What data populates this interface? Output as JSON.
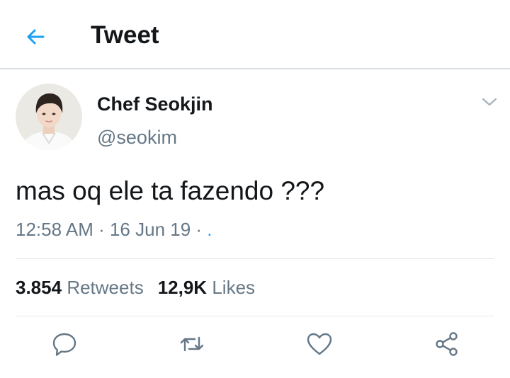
{
  "header": {
    "title": "Tweet",
    "back_icon": "arrow-left-icon",
    "accent_color": "#1da1f2"
  },
  "tweet": {
    "author": {
      "name": "Chef Seokjin",
      "handle": "@seokim",
      "avatar": "profile-photo"
    },
    "text": "mas oq ele ta fazendo ???",
    "time": "12:58 AM",
    "sep1": " · ",
    "date": "16 Jun 19",
    "sep2": " · ",
    "via": ".",
    "stats": {
      "retweets_count": "3.854",
      "retweets_label": "Retweets",
      "likes_count": "12,9K",
      "likes_label": "Likes"
    }
  },
  "actions": [
    {
      "icon": "reply-icon"
    },
    {
      "icon": "retweet-icon"
    },
    {
      "icon": "like-icon"
    },
    {
      "icon": "share-icon"
    }
  ],
  "colors": {
    "text_primary": "#14171a",
    "text_secondary": "#657786",
    "divider": "#e1e8ed"
  }
}
